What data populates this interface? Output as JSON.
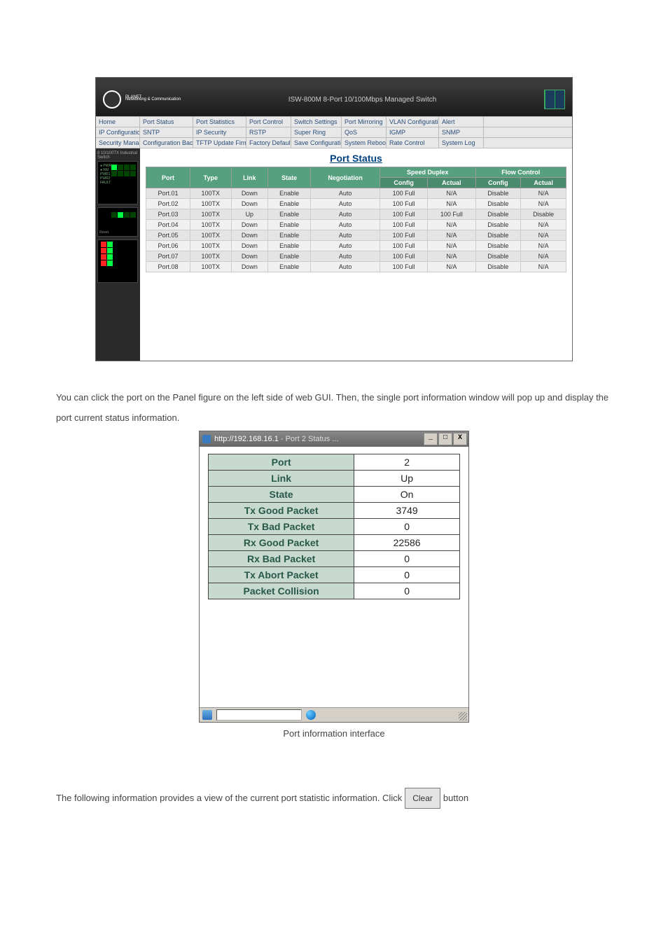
{
  "header": {
    "brand": "PLANET",
    "brand_sub": "Networking & Communication",
    "title": "ISW-800M 8-Port 10/100Mbps Managed Switch"
  },
  "nav": {
    "rows": [
      [
        "Home",
        "Port Status",
        "Port Statistics",
        "Port Control",
        "Switch Settings",
        "Port Mirroring",
        "VLAN Configuration",
        "Alert",
        ""
      ],
      [
        "IP Configuration",
        "SNTP",
        "IP Security",
        "RSTP",
        "Super Ring",
        "QoS",
        "IGMP",
        "SNMP",
        ""
      ],
      [
        "Security Manager",
        "Configuration Backup",
        "TFTP Update Firmware",
        "Factory Default",
        "Save Configuration",
        "System Reboot",
        "Rate Control",
        "System Log",
        ""
      ]
    ]
  },
  "side_label_top": "8 10/100TX Industrial Switch",
  "port_status": {
    "title": "Port Status",
    "headers": {
      "port": "Port",
      "type": "Type",
      "link": "Link",
      "state": "State",
      "negotiation": "Negotiation",
      "speed_duplex": "Speed Duplex",
      "flow_control": "Flow Control",
      "config": "Config",
      "actual": "Actual"
    },
    "rows": [
      {
        "port": "Port.01",
        "type": "100TX",
        "link": "Down",
        "state": "Enable",
        "neg": "Auto",
        "sd_cfg": "100 Full",
        "sd_act": "N/A",
        "fc_cfg": "Disable",
        "fc_act": "N/A"
      },
      {
        "port": "Port.02",
        "type": "100TX",
        "link": "Down",
        "state": "Enable",
        "neg": "Auto",
        "sd_cfg": "100 Full",
        "sd_act": "N/A",
        "fc_cfg": "Disable",
        "fc_act": "N/A"
      },
      {
        "port": "Port.03",
        "type": "100TX",
        "link": "Up",
        "state": "Enable",
        "neg": "Auto",
        "sd_cfg": "100 Full",
        "sd_act": "100 Full",
        "fc_cfg": "Disable",
        "fc_act": "Disable"
      },
      {
        "port": "Port.04",
        "type": "100TX",
        "link": "Down",
        "state": "Enable",
        "neg": "Auto",
        "sd_cfg": "100 Full",
        "sd_act": "N/A",
        "fc_cfg": "Disable",
        "fc_act": "N/A"
      },
      {
        "port": "Port.05",
        "type": "100TX",
        "link": "Down",
        "state": "Enable",
        "neg": "Auto",
        "sd_cfg": "100 Full",
        "sd_act": "N/A",
        "fc_cfg": "Disable",
        "fc_act": "N/A"
      },
      {
        "port": "Port.06",
        "type": "100TX",
        "link": "Down",
        "state": "Enable",
        "neg": "Auto",
        "sd_cfg": "100 Full",
        "sd_act": "N/A",
        "fc_cfg": "Disable",
        "fc_act": "N/A"
      },
      {
        "port": "Port.07",
        "type": "100TX",
        "link": "Down",
        "state": "Enable",
        "neg": "Auto",
        "sd_cfg": "100 Full",
        "sd_act": "N/A",
        "fc_cfg": "Disable",
        "fc_act": "N/A"
      },
      {
        "port": "Port.08",
        "type": "100TX",
        "link": "Down",
        "state": "Enable",
        "neg": "Auto",
        "sd_cfg": "100 Full",
        "sd_act": "N/A",
        "fc_cfg": "Disable",
        "fc_act": "N/A"
      }
    ]
  },
  "para1": "You can click the port on the Panel figure on the left side of web GUI. Then, the single port information window will pop up and display the port current status information.",
  "popup": {
    "title_url": "http://192.168.16.1",
    "title_rest": " - Port 2 Status ...",
    "rows": [
      {
        "k": "Port",
        "v": "2"
      },
      {
        "k": "Link",
        "v": "Up"
      },
      {
        "k": "State",
        "v": "On"
      },
      {
        "k": "Tx Good Packet",
        "v": "3749"
      },
      {
        "k": "Tx Bad Packet",
        "v": "0"
      },
      {
        "k": "Rx Good Packet",
        "v": "22586"
      },
      {
        "k": "Rx Bad Packet",
        "v": "0"
      },
      {
        "k": "Tx Abort Packet",
        "v": "0"
      },
      {
        "k": "Packet Collision",
        "v": "0"
      }
    ]
  },
  "caption": "Port information interface",
  "para2_a": "The following information provides a view of the current port statistic information. Click",
  "para2_btn": "Clear",
  "para2_b": "button"
}
